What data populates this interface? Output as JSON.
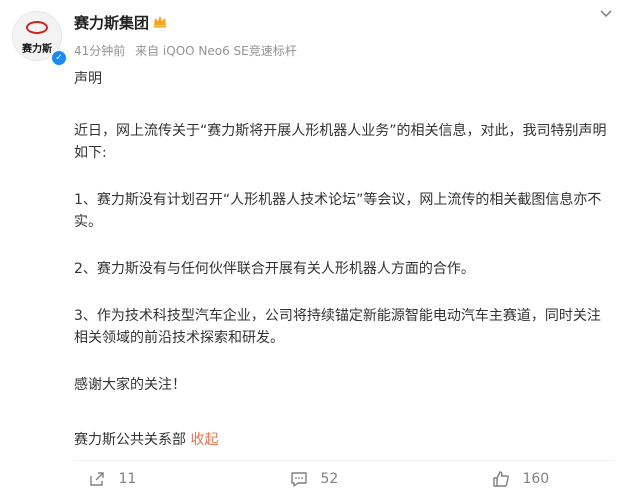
{
  "header": {
    "avatar_text": "赛力斯",
    "account_name": "赛力斯集团",
    "time": "41分钟前",
    "source": "来自 iQOO Neo6 SE竞速标杆"
  },
  "post": {
    "title": "声明",
    "p1": "近日，网上流传关于“赛力斯将开展人形机器人业务”的相关信息，对此，我司特别声明如下:",
    "p2": "1、赛力斯没有计划召开“人形机器人技术论坛”等会议，网上流传的相关截图信息亦不实。",
    "p3": "2、赛力斯没有与任何伙伴联合开展有关人形机器人方面的合作。",
    "p4": "3、作为技术科技型汽车企业，公司将持续锚定新能源智能电动汽车主赛道，同时关注相关领域的前沿技术探索和研发。",
    "p5": "感谢大家的关注！",
    "signature": "赛力斯公共关系部",
    "collapse_label": "收起"
  },
  "actions": {
    "share_count": "11",
    "comment_count": "52",
    "like_count": "160"
  },
  "colors": {
    "verified": "#1a8cf0",
    "crown": "#f4a623",
    "link": "#eb7350",
    "meta": "#939393"
  },
  "icons": {
    "verified": "verified-icon",
    "crown": "crown-icon",
    "more": "chevron-down-icon",
    "share": "share-icon",
    "comment": "comment-icon",
    "like": "thumbs-up-icon"
  }
}
